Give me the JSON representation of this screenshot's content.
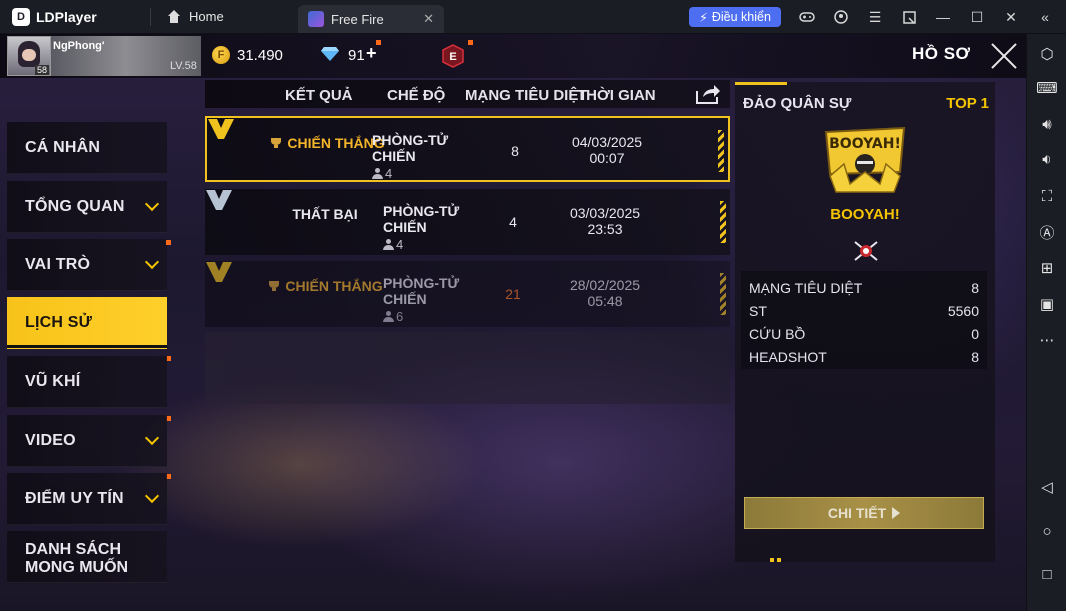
{
  "emulator": {
    "brand": "LDPlayer",
    "tabs": [
      {
        "label": "Home"
      },
      {
        "label": "Free Fire"
      }
    ],
    "control_button": "Điều khiển"
  },
  "player": {
    "name": "NgPhong'",
    "level": "LV.58",
    "avatar_level": "58",
    "gold": "31.490",
    "diamonds": "91",
    "plus": "+"
  },
  "page": {
    "title": "HỒ SƠ"
  },
  "menu": [
    {
      "label": "CÁ NHÂN",
      "chevron": false
    },
    {
      "label": "TỔNG QUAN",
      "chevron": true
    },
    {
      "label": "VAI TRÒ",
      "chevron": true
    },
    {
      "label": "LỊCH SỬ",
      "chevron": false,
      "active": true
    },
    {
      "label": "VŨ KHÍ",
      "chevron": false
    },
    {
      "label": "VIDEO",
      "chevron": true
    },
    {
      "label": "ĐIỂM UY TÍN",
      "chevron": true
    },
    {
      "label_line1": "DANH SÁCH",
      "label_line2": "MONG MUỐN",
      "chevron": false
    }
  ],
  "table": {
    "headers": {
      "result": "KẾT QUẢ",
      "mode": "CHẾ ĐỘ",
      "kills": "MẠNG TIÊU DIỆT",
      "time": "THỜI GIAN"
    },
    "rows": [
      {
        "result": "CHIẾN THẮNG",
        "mode": "PHÒNG-TỬ CHIẾN",
        "players": "4",
        "kills": "8",
        "date": "04/03/2025",
        "clock": "00:07"
      },
      {
        "result": "THẤT BẠI",
        "mode": "PHÒNG-TỬ CHIẾN",
        "players": "4",
        "kills": "4",
        "date": "03/03/2025",
        "clock": "23:53"
      },
      {
        "result": "CHIẾN THẮNG",
        "mode": "PHÒNG-TỬ CHIẾN",
        "players": "6",
        "kills": "21",
        "date": "28/02/2025",
        "clock": "05:48"
      }
    ]
  },
  "detail": {
    "map_name": "ĐẢO QUÂN SỰ",
    "rank": "TOP 1",
    "booyah_art_text": "BOOYAH!",
    "booyah_label": "BOOYAH!",
    "stats": [
      {
        "label": "MẠNG TIÊU DIỆT",
        "value": "8"
      },
      {
        "label": "ST",
        "value": "5560"
      },
      {
        "label": "CỨU BỒ",
        "value": "0"
      },
      {
        "label": "HEADSHOT",
        "value": "8"
      }
    ],
    "button": "CHI TIẾT"
  },
  "colors": {
    "accent_yellow": "#f5c400",
    "win_orange": "#f5b52a",
    "kills_orange": "#ff6a1a",
    "emulator_blue": "#4d6ef0"
  }
}
